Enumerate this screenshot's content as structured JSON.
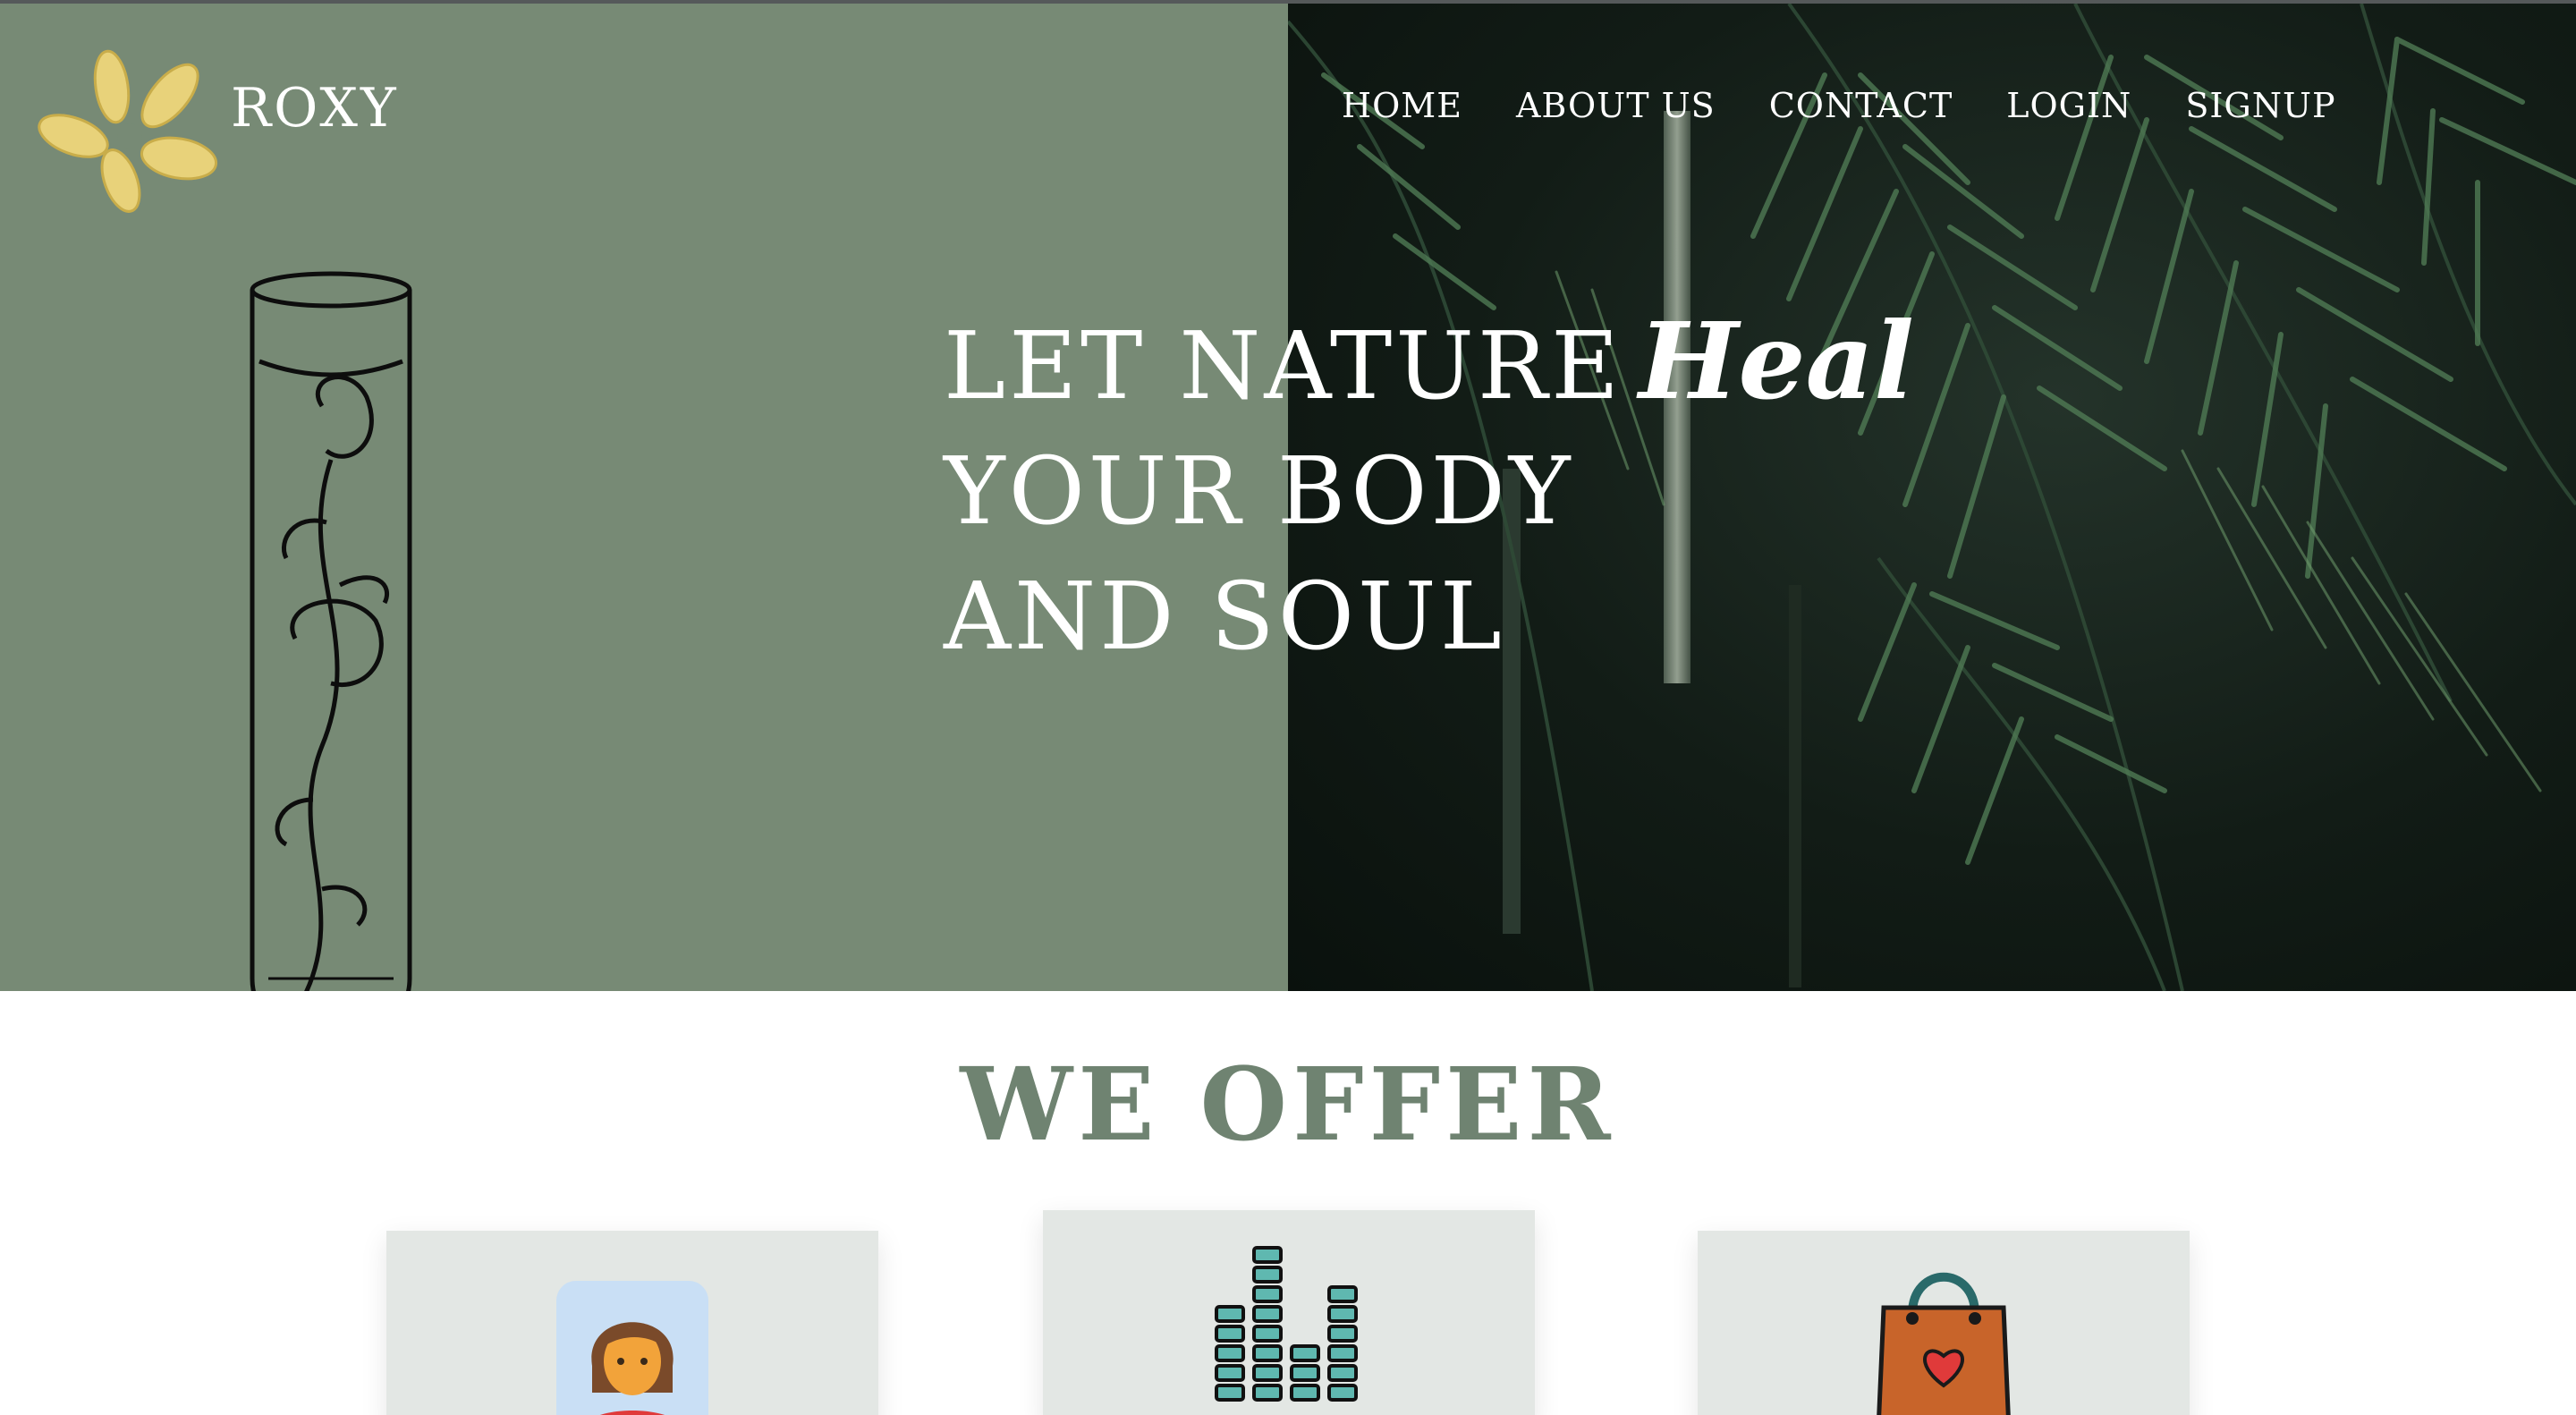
{
  "brand": {
    "name": "ROXY",
    "logo_icon": "flower-logo-icon",
    "logo_color": "#e8d27a"
  },
  "nav": {
    "items": [
      {
        "label": "HOME"
      },
      {
        "label": "ABOUT US"
      },
      {
        "label": "CONTACT"
      },
      {
        "label": "LOGIN"
      },
      {
        "label": "SIGNUP"
      }
    ]
  },
  "hero": {
    "line1": "LET NATURE",
    "line1_script": "Heal",
    "line2": "YOUR BODY",
    "line3": "AND SOUL",
    "illustration": "test-tube-rose-icon",
    "background_color": "#778a75",
    "photo": "palm-leaves-photo"
  },
  "offer": {
    "title": "WE OFFER",
    "title_color": "#6f8371",
    "cards": [
      {
        "icon": "person-avatar-icon"
      },
      {
        "icon": "equalizer-bars-icon"
      },
      {
        "icon": "shopping-bag-heart-icon"
      }
    ]
  }
}
